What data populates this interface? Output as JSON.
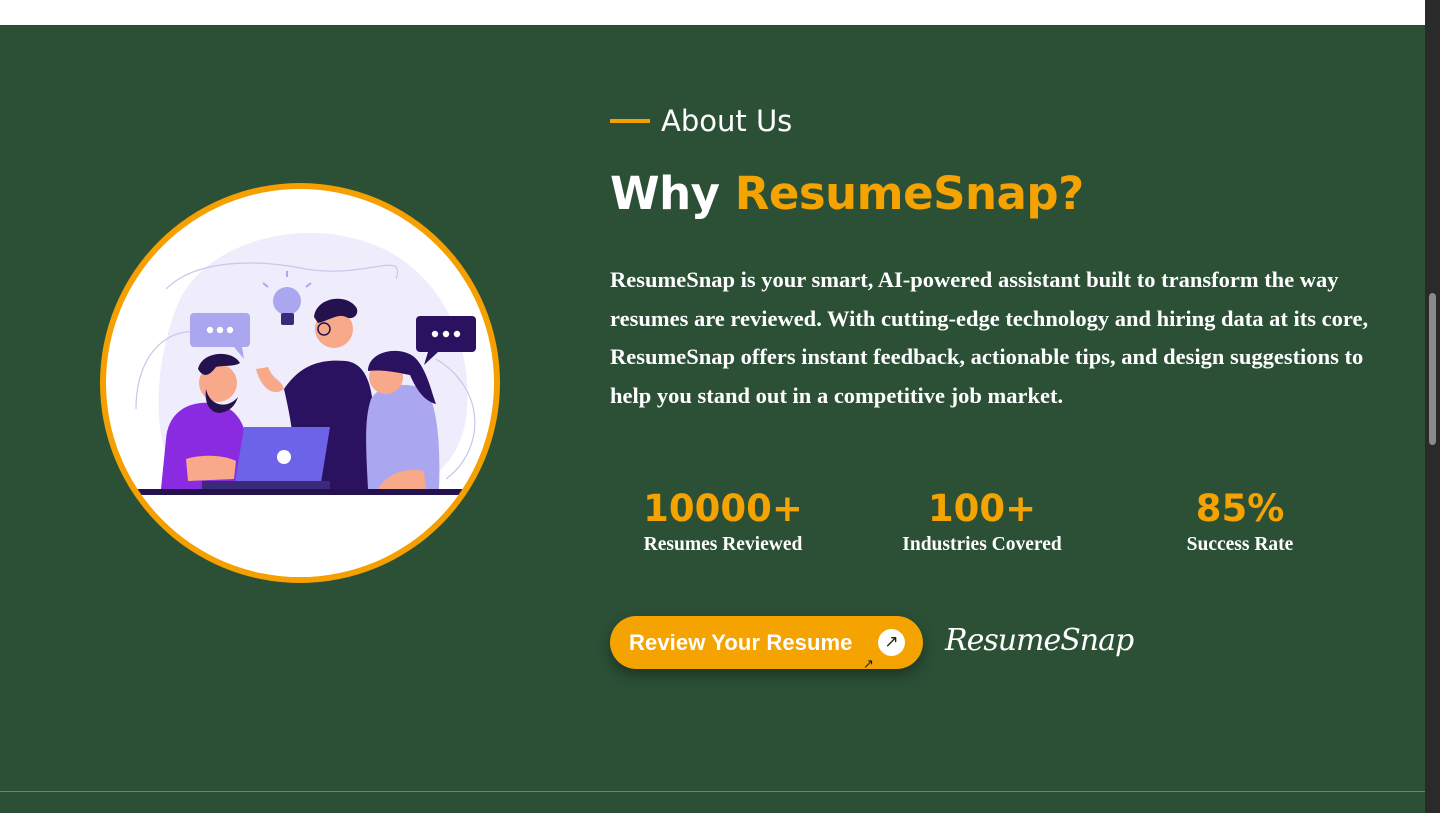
{
  "about": {
    "label": "About Us"
  },
  "heading": {
    "prefix": "Why",
    "brand": "ResumeSnap?"
  },
  "description": "ResumeSnap is your smart, AI-powered assistant built to transform the way resumes are reviewed. With cutting-edge technology and hiring data at its core, ResumeSnap offers instant feedback, actionable tips, and design suggestions to help you stand out in a competitive job market.",
  "stats": [
    {
      "value": "10000+",
      "label": "Resumes Reviewed"
    },
    {
      "value": "100+",
      "label": "Industries Covered"
    },
    {
      "value": "85%",
      "label": "Success Rate"
    }
  ],
  "cta": {
    "label": "Review Your Resume",
    "icon": "arrow-up-right-icon"
  },
  "signature": "ResumeSnap",
  "colors": {
    "background": "#2b5036",
    "accent": "#f5a300",
    "text": "#ffffff"
  }
}
